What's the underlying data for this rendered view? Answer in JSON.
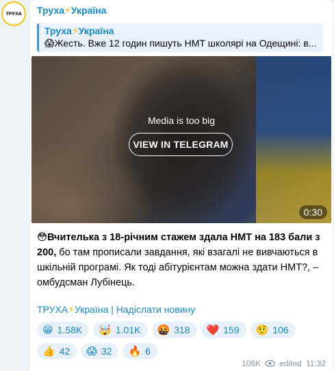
{
  "channel": {
    "name_part1": "Труха",
    "bolt": "⚡",
    "name_part2": "Україна",
    "avatar_text": "ТРУХА"
  },
  "reply": {
    "name_part1": "Труха",
    "bolt": "⚡",
    "name_part2": "Україна",
    "text": "😱Жесть. Вже 12 годин пишуть НМТ школярі на Одещині: в..."
  },
  "media": {
    "message": "Media is too big",
    "button": "VIEW IN TELEGRAM",
    "duration": "0:30"
  },
  "post": {
    "bold_text": "😳Вчителька з 18-річним стажем здала НМТ на 183 бали з 200,",
    "body_text": " бо там прописали завдання, які взагалі не вивчаються в шкільній програмі. Як тоді абітурієнтам можна здати НМТ?, – омбудсман Лубінець."
  },
  "footer_link": {
    "part1": "ТРУХА",
    "bolt": "⚡",
    "part2": "Україна | Надіслати новину"
  },
  "reactions": [
    {
      "emoji": "😁",
      "count": "1.58K"
    },
    {
      "emoji": "🤯",
      "count": "1.01K"
    },
    {
      "emoji": "🤬",
      "count": "318"
    },
    {
      "emoji": "❤️",
      "count": "159"
    },
    {
      "emoji": "🤨",
      "count": "106"
    },
    {
      "emoji": "👍",
      "count": "42"
    },
    {
      "emoji": "😱",
      "count": "32"
    },
    {
      "emoji": "🔥",
      "count": "6"
    }
  ],
  "meta": {
    "views": "106K",
    "edited": "edited",
    "time": "11:32"
  }
}
